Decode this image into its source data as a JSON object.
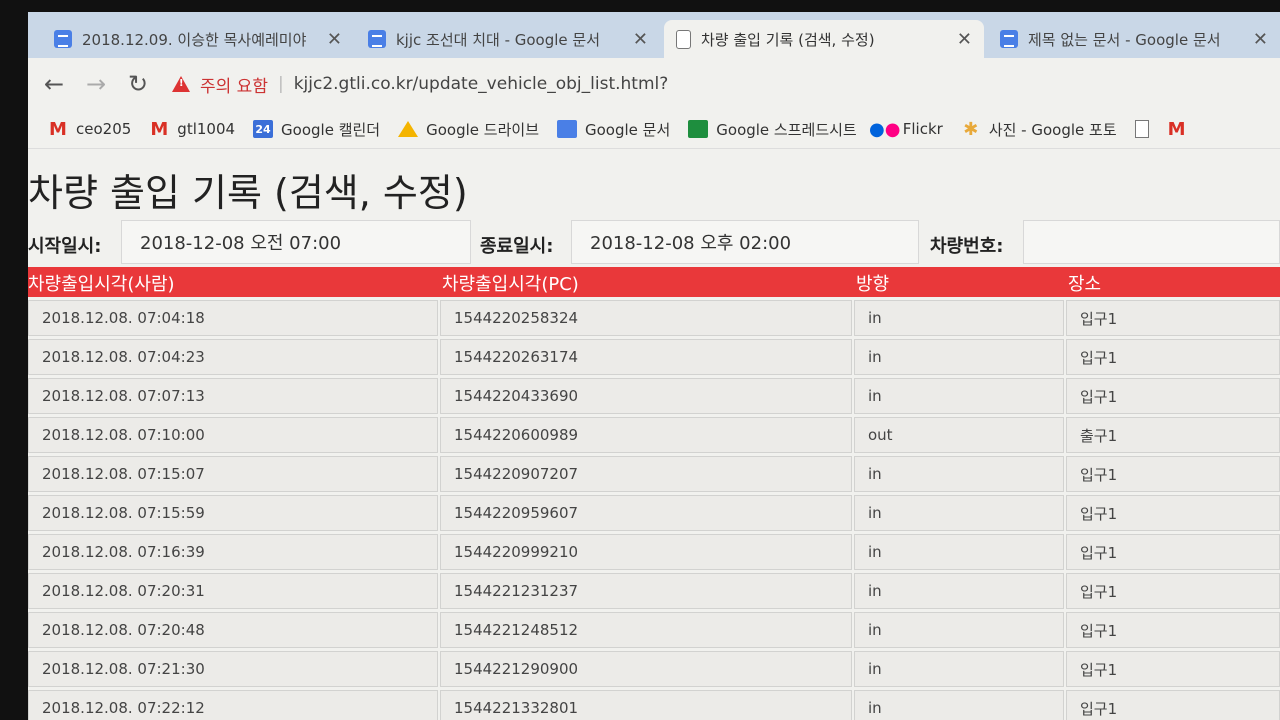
{
  "browser": {
    "tabs": [
      {
        "title": "2018.12.09. 이승한 목사예레미야",
        "icon": "google-docs-icon"
      },
      {
        "title": "kjjc 조선대 치대 - Google 문서",
        "icon": "google-docs-icon"
      },
      {
        "title": "차량 출입 기록 (검색, 수정)",
        "icon": "page-icon",
        "active": true
      },
      {
        "title": "제목 없는 문서 - Google 문서",
        "icon": "google-docs-icon"
      }
    ],
    "tab_close": "✕",
    "security_warning": "주의 요함",
    "url": "kjjc2.gtli.co.kr/update_vehicle_obj_list.html?"
  },
  "bookmarks": [
    {
      "label": "ceo205",
      "icon": "gmail-icon"
    },
    {
      "label": "gtl1004",
      "icon": "gmail-icon"
    },
    {
      "label": "Google 캘린더",
      "icon": "calendar-icon",
      "badge": "24"
    },
    {
      "label": "Google 드라이브",
      "icon": "drive-icon"
    },
    {
      "label": "Google 문서",
      "icon": "docs-icon"
    },
    {
      "label": "Google 스프레드시트",
      "icon": "sheets-icon"
    },
    {
      "label": "Flickr",
      "icon": "flickr-icon"
    },
    {
      "label": "사진 - Google 포토",
      "icon": "photos-icon"
    }
  ],
  "page": {
    "title": "차량 출입 기록 (검색, 수정)",
    "filters": {
      "start_label": "시작일시:",
      "start_value": "2018-12-08 오전 07:00",
      "end_label": "종료일시:",
      "end_value": "2018-12-08 오후 02:00",
      "vehicle_label": "차량번호:",
      "vehicle_value": ""
    },
    "columns": [
      "차량출입시각(사람)",
      "차량출입시각(PC)",
      "방향",
      "장소"
    ],
    "rows": [
      [
        "2018.12.08. 07:04:18",
        "1544220258324",
        "in",
        "입구1"
      ],
      [
        "2018.12.08. 07:04:23",
        "1544220263174",
        "in",
        "입구1"
      ],
      [
        "2018.12.08. 07:07:13",
        "1544220433690",
        "in",
        "입구1"
      ],
      [
        "2018.12.08. 07:10:00",
        "1544220600989",
        "out",
        "출구1"
      ],
      [
        "2018.12.08. 07:15:07",
        "1544220907207",
        "in",
        "입구1"
      ],
      [
        "2018.12.08. 07:15:59",
        "1544220959607",
        "in",
        "입구1"
      ],
      [
        "2018.12.08. 07:16:39",
        "1544220999210",
        "in",
        "입구1"
      ],
      [
        "2018.12.08. 07:20:31",
        "1544221231237",
        "in",
        "입구1"
      ],
      [
        "2018.12.08. 07:20:48",
        "1544221248512",
        "in",
        "입구1"
      ],
      [
        "2018.12.08. 07:21:30",
        "1544221290900",
        "in",
        "입구1"
      ],
      [
        "2018.12.08. 07:22:12",
        "1544221332801",
        "in",
        "입구1"
      ]
    ]
  },
  "colors": {
    "header_bg": "#e9383a",
    "tabstrip_bg": "#c9d7e7",
    "warning": "#c33"
  }
}
